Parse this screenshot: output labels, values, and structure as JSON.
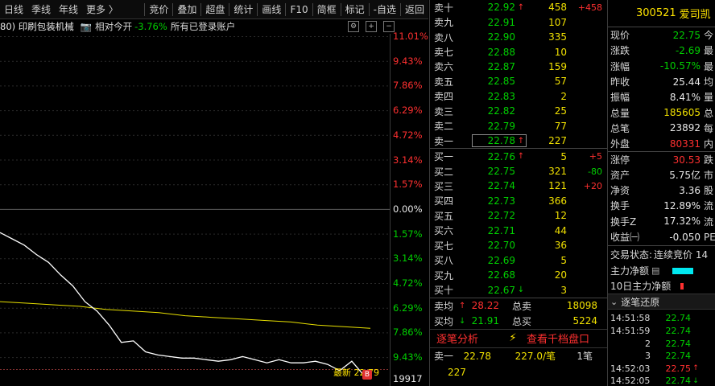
{
  "toolbar": {
    "left": [
      "日线",
      "季线",
      "年线",
      "更多 〉"
    ],
    "right": [
      "竞价",
      "叠加",
      "超盘",
      "统计",
      "画线",
      "F10",
      "简框",
      "标记",
      "-自选",
      "返回"
    ]
  },
  "info": {
    "sector": "80) 印刷包装机械",
    "open_label": "相对今开",
    "open_pct": "-3.76%",
    "account": "所有已登录账户"
  },
  "chart_data": {
    "type": "line",
    "y_pct_labels": [
      "11.01%",
      "9.43%",
      "7.86%",
      "6.29%",
      "4.72%",
      "3.14%",
      "1.57%",
      "0.00%",
      "1.57%",
      "3.14%",
      "4.72%",
      "6.29%",
      "7.86%",
      "9.43%"
    ],
    "ylim_pct": [
      -11.01,
      11.01
    ],
    "prev_close": 25.44,
    "price_series": [
      -1.5,
      -1.9,
      -2.3,
      -2.9,
      -3.4,
      -4.2,
      -4.9,
      -5.9,
      -6.5,
      -7.4,
      -8.5,
      -8.4,
      -9.1,
      -9.3,
      -9.4,
      -9.5,
      -9.5,
      -9.6,
      -9.7,
      -9.6,
      -9.4,
      -9.6,
      -9.8,
      -9.6,
      -9.8,
      -9.8,
      -9.7,
      -9.9,
      -10.3,
      -9.7,
      -10.6
    ],
    "avg_series": [
      -5.9,
      -6.0,
      -6.1,
      -6.2,
      -6.4,
      -6.5,
      -6.6,
      -6.8,
      -6.9,
      -7.0,
      -7.1,
      -7.2,
      -7.4,
      -7.5,
      -7.6
    ],
    "last_price_label": "最新 22.79",
    "volume_label": "19917"
  },
  "book": {
    "asks": [
      {
        "label": "卖十",
        "price": "22.92",
        "arrow": "↑",
        "vol": "458",
        "chg": "+458"
      },
      {
        "label": "卖九",
        "price": "22.91",
        "arrow": "",
        "vol": "107",
        "chg": ""
      },
      {
        "label": "卖八",
        "price": "22.90",
        "arrow": "",
        "vol": "335",
        "chg": ""
      },
      {
        "label": "卖七",
        "price": "22.88",
        "arrow": "",
        "vol": "10",
        "chg": ""
      },
      {
        "label": "卖六",
        "price": "22.87",
        "arrow": "",
        "vol": "159",
        "chg": ""
      },
      {
        "label": "卖五",
        "price": "22.85",
        "arrow": "",
        "vol": "57",
        "chg": ""
      },
      {
        "label": "卖四",
        "price": "22.83",
        "arrow": "",
        "vol": "2",
        "chg": ""
      },
      {
        "label": "卖三",
        "price": "22.82",
        "arrow": "",
        "vol": "25",
        "chg": ""
      },
      {
        "label": "卖二",
        "price": "22.79",
        "arrow": "",
        "vol": "77",
        "chg": ""
      },
      {
        "label": "卖一",
        "price": "22.78",
        "arrow": "↑",
        "vol": "227",
        "chg": ""
      }
    ],
    "bids": [
      {
        "label": "买一",
        "price": "22.76",
        "arrow": "↑",
        "vol": "5",
        "chg": "+5"
      },
      {
        "label": "买二",
        "price": "22.75",
        "arrow": "",
        "vol": "321",
        "chg": "-80"
      },
      {
        "label": "买三",
        "price": "22.74",
        "arrow": "",
        "vol": "121",
        "chg": "+20"
      },
      {
        "label": "买四",
        "price": "22.73",
        "arrow": "",
        "vol": "366",
        "chg": ""
      },
      {
        "label": "买五",
        "price": "22.72",
        "arrow": "",
        "vol": "12",
        "chg": ""
      },
      {
        "label": "买六",
        "price": "22.71",
        "arrow": "",
        "vol": "44",
        "chg": ""
      },
      {
        "label": "买七",
        "price": "22.70",
        "arrow": "",
        "vol": "36",
        "chg": ""
      },
      {
        "label": "买八",
        "price": "22.69",
        "arrow": "",
        "vol": "5",
        "chg": ""
      },
      {
        "label": "买九",
        "price": "22.68",
        "arrow": "",
        "vol": "20",
        "chg": ""
      },
      {
        "label": "买十",
        "price": "22.67",
        "arrow": "↓",
        "vol": "3",
        "chg": ""
      }
    ],
    "avg_sell": {
      "label": "卖均",
      "price": "28.22",
      "total_label": "总卖",
      "total": "18098"
    },
    "avg_buy": {
      "label": "买均",
      "price": "21.91",
      "total_label": "总买",
      "total": "5224"
    },
    "tab1": "逐笔分析",
    "tab2": "查看千档盘口",
    "tick": {
      "label": "卖一",
      "price": "22.78",
      "vol": "227.0/笔",
      "count": "1笔",
      "qty": "227"
    }
  },
  "panel": {
    "code": "300521",
    "name": "爱司凯",
    "rows": [
      {
        "label": "现价",
        "value": "22.75",
        "tail": "今"
      },
      {
        "label": "涨跌",
        "value": "-2.69",
        "tail": "最"
      },
      {
        "label": "涨幅",
        "value": "-10.57%",
        "tail": "最"
      },
      {
        "label": "昨收",
        "value": "25.44",
        "tail": "均"
      },
      {
        "label": "振幅",
        "value": "8.41%",
        "tail": "量"
      },
      {
        "label": "总量",
        "value": "185605",
        "tail": "总"
      },
      {
        "label": "总笔",
        "value": "23892",
        "tail": "每"
      },
      {
        "label": "外盘",
        "value": "80331",
        "tail": "内"
      },
      {
        "label": "涨停",
        "value": "30.53",
        "tail": "跌"
      },
      {
        "label": "资产",
        "value": "5.75亿",
        "tail": "市"
      },
      {
        "label": "净资",
        "value": "3.36",
        "tail": "股"
      },
      {
        "label": "换手",
        "value": "12.89%",
        "tail": "流"
      },
      {
        "label": "换手Z",
        "value": "17.32%",
        "tail": "流"
      },
      {
        "label": "收益㈠",
        "value": "-0.050",
        "tail": "PE"
      }
    ],
    "trade_state_label": "交易状态:",
    "trade_state": "连续竞价 14",
    "main_net": "主力净额",
    "main_net_10": "10日主力净额",
    "ticks_title": "逐笔还原",
    "ticks": [
      {
        "time": "14:51:58",
        "price": "22.74",
        "arrow": ""
      },
      {
        "time": "14:51:59",
        "price": "22.74",
        "arrow": ""
      },
      {
        "time": "2",
        "price": "22.74",
        "arrow": ""
      },
      {
        "time": "3",
        "price": "22.74",
        "arrow": ""
      },
      {
        "time": "14:52:03",
        "price": "22.75",
        "arrow": "↑"
      },
      {
        "time": "14:52:05",
        "price": "22.74",
        "arrow": "↓"
      }
    ]
  },
  "colors": {
    "up": "#ff3030",
    "down": "#00d000",
    "price_line": "#ffffff",
    "avg_line": "#e8e000",
    "volume": "#f0e000"
  }
}
